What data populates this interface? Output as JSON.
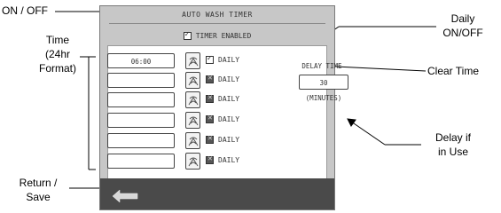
{
  "screen": {
    "title": "AUTO WASH TIMER",
    "timer_enabled_label": "TIMER ENABLED",
    "timer_enabled": true,
    "rows": [
      {
        "time": "06:00",
        "daily_label": "DAILY",
        "daily_checked": true
      },
      {
        "time": "",
        "daily_label": "DAILY",
        "daily_checked": false
      },
      {
        "time": "",
        "daily_label": "DAILY",
        "daily_checked": false
      },
      {
        "time": "",
        "daily_label": "DAILY",
        "daily_checked": false
      },
      {
        "time": "",
        "daily_label": "DAILY",
        "daily_checked": false
      },
      {
        "time": "",
        "daily_label": "DAILY",
        "daily_checked": false
      }
    ],
    "delay_label": "DELAY TIME",
    "delay_value": "30 (MINUTES)",
    "back_icon": "return-arrow-icon"
  },
  "callouts": {
    "on_off": "ON / OFF",
    "time_line1": "Time",
    "time_line2": "(24hr",
    "time_line3": "Format)",
    "return_line1": "Return /",
    "return_line2": "Save",
    "daily_line1": "Daily",
    "daily_line2": "ON/OFF",
    "clear_time": "Clear Time",
    "delay_line1": "Delay if",
    "delay_line2": "in Use"
  }
}
